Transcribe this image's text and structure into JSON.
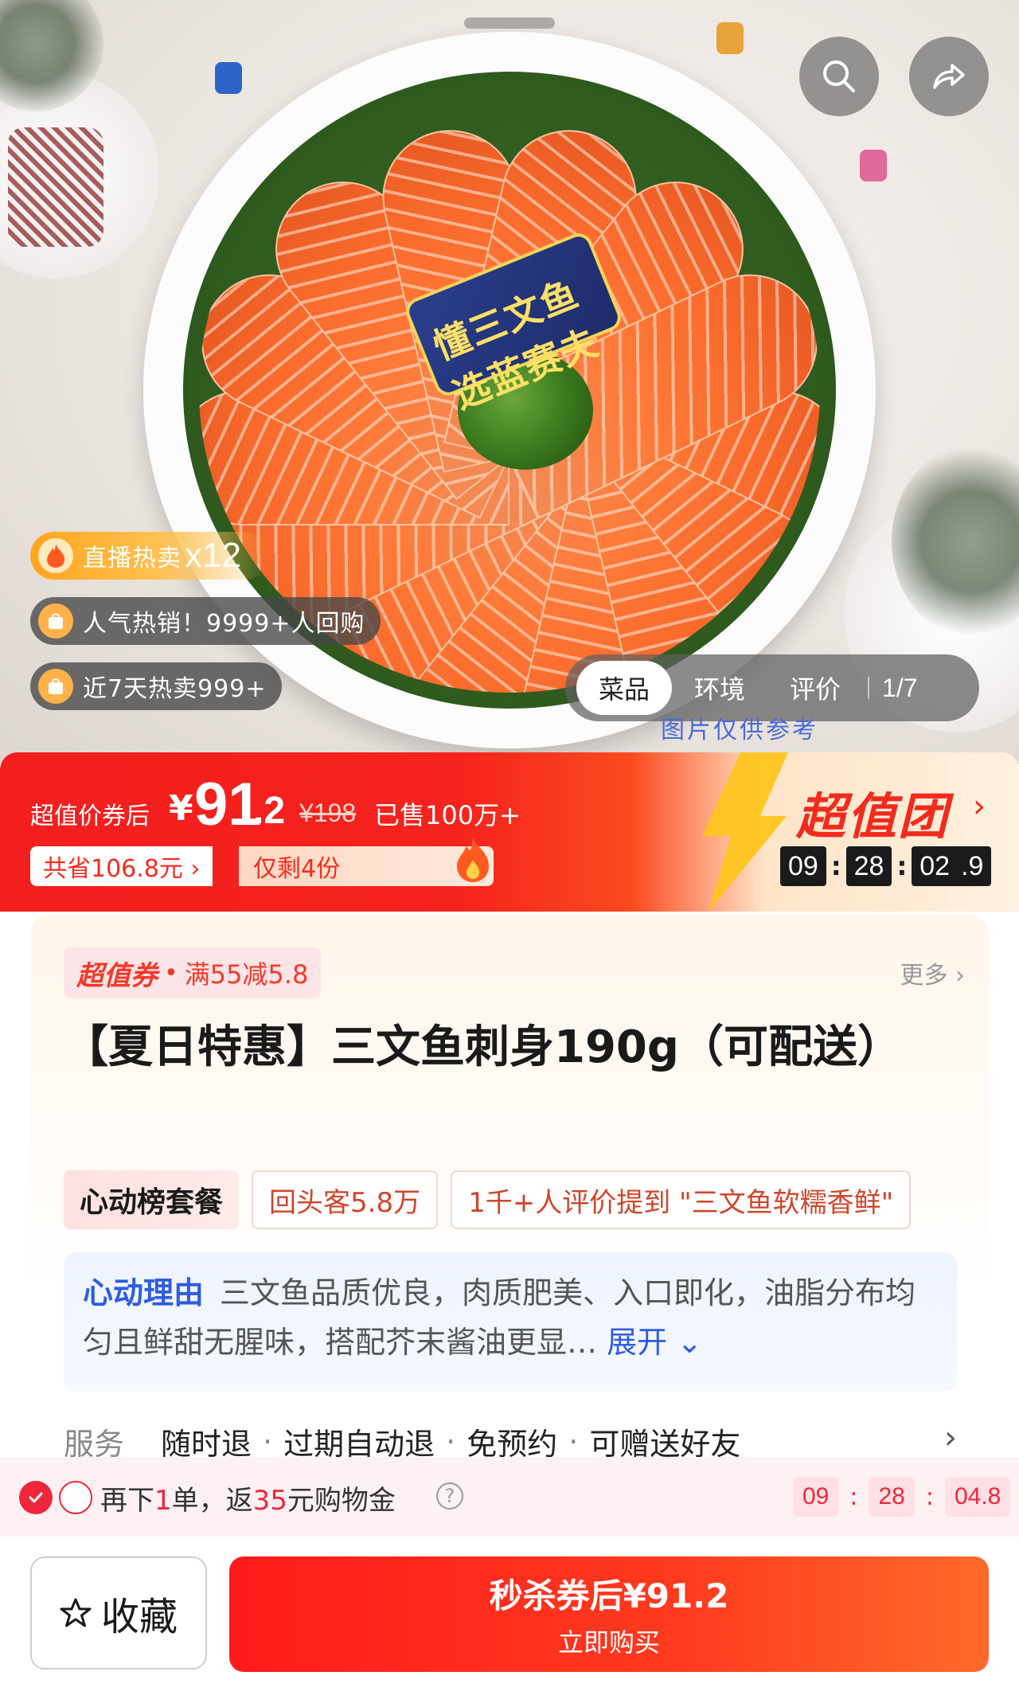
{
  "hero": {
    "package_tag": "懂三文鱼 选蓝赛夫",
    "badges": [
      {
        "text": "直播热卖",
        "count": "x12",
        "icon": "flame-icon"
      },
      {
        "text": "人气热销！9999+人回购",
        "icon": "shopping-bag-icon"
      },
      {
        "text": "近7天热卖999+",
        "icon": "shopping-bag-icon"
      }
    ],
    "gallery_tabs": [
      "菜品",
      "环境",
      "评价"
    ],
    "gallery_count": "1/7",
    "disclaimer": "图片仅供参考"
  },
  "price": {
    "label": "超值价券后",
    "currency": "¥",
    "integer": "91",
    "decimal": ".2",
    "original": "¥198",
    "sold": "已售100万+",
    "saved": "共省106.8元 ›",
    "remaining": "仅剩4份",
    "promo_title": "超值团",
    "promo_arrow": "›",
    "countdown": [
      "09",
      "28",
      "02",
      ".9"
    ],
    "accent_color": "#f31e1e"
  },
  "deal": {
    "coupon_brand": "超值券",
    "coupon_text": "满55减5.8",
    "more_label": "更多 ›",
    "title": "【夏日特惠】三文鱼刺身190g（可配送）",
    "tags": [
      "心动榜套餐",
      "回头客5.8万",
      "1千+人评价提到 \"三文鱼软糯香鲜\""
    ],
    "reason_label": "心动理由",
    "reason_text": "三文鱼品质优良，肉质肥美、入口即化，油脂分布均匀且鲜甜无腥味，搭配芥末酱油更显…",
    "reason_expand": "展开",
    "service_label": "服务",
    "services": [
      "随时退",
      "过期自动退",
      "免预约",
      "可赠送好友"
    ]
  },
  "rebate": {
    "prefix": "再下",
    "count": "1",
    "middle": "单，返",
    "amount": "35",
    "suffix": "元购物金",
    "countdown": [
      "09",
      "28",
      "04.8"
    ]
  },
  "bottom": {
    "favorite_label": "收藏",
    "buy_main": "秒杀券后¥91.2",
    "buy_sub": "立即购买"
  }
}
